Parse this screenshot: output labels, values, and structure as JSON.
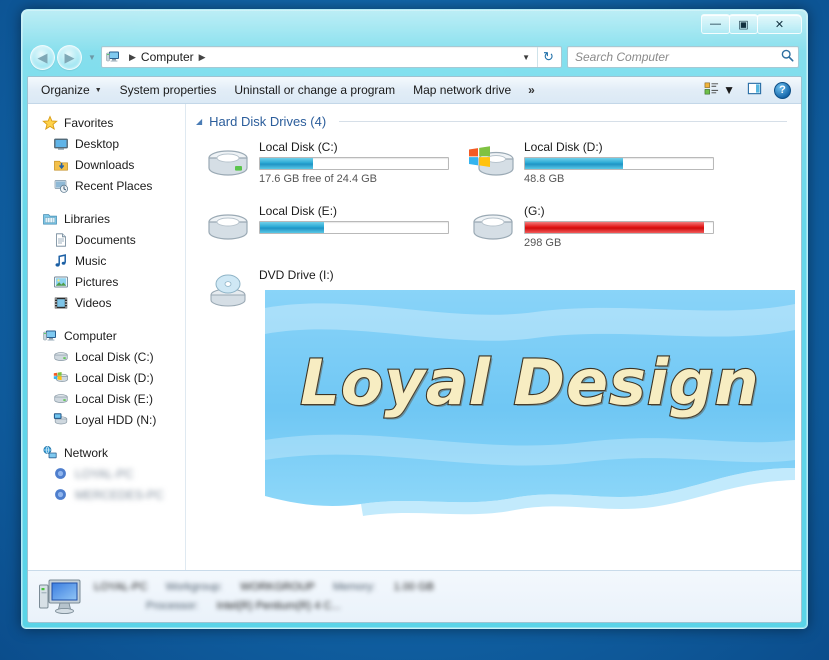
{
  "window": {
    "title": "",
    "caption_buttons": [
      {
        "name": "minimize",
        "glyph": "—"
      },
      {
        "name": "maximize",
        "glyph": "▣"
      },
      {
        "name": "close",
        "glyph": "✕"
      }
    ]
  },
  "navbar": {
    "back_glyph": "◀",
    "forward_glyph": "▶",
    "history_glyph": "▼",
    "breadcrumb_icon": "computer-icon",
    "breadcrumb": "Computer",
    "separator": "▶",
    "dropdown_glyph": "▼",
    "refresh_glyph": "↻",
    "search_placeholder": "Search Computer",
    "search_value": "",
    "search_icon": "search-icon"
  },
  "commandbar": {
    "organize": "Organize",
    "organize_caret": "▼",
    "system_properties": "System properties",
    "uninstall": "Uninstall or change a program",
    "map_network_drive": "Map network drive",
    "overflow": "»",
    "view_caret": "▼",
    "help_glyph": "?"
  },
  "navpane": {
    "groups": [
      {
        "header": {
          "label": "Favorites",
          "icon": "favorites-star-icon"
        },
        "items": [
          {
            "label": "Desktop",
            "icon": "desktop-icon",
            "blurred": false
          },
          {
            "label": "Downloads",
            "icon": "downloads-folder-icon",
            "blurred": false
          },
          {
            "label": "Recent Places",
            "icon": "recent-places-icon",
            "blurred": false
          }
        ]
      },
      {
        "header": {
          "label": "Libraries",
          "icon": "libraries-icon"
        },
        "items": [
          {
            "label": "Documents",
            "icon": "documents-icon",
            "blurred": false
          },
          {
            "label": "Music",
            "icon": "music-note-icon",
            "blurred": false
          },
          {
            "label": "Pictures",
            "icon": "pictures-icon",
            "blurred": false
          },
          {
            "label": "Videos",
            "icon": "videos-icon",
            "blurred": false
          }
        ]
      },
      {
        "header": {
          "label": "Computer",
          "icon": "computer-icon"
        },
        "items": [
          {
            "label": "Local Disk (C:)",
            "icon": "drive-icon",
            "blurred": false
          },
          {
            "label": "Local Disk (D:)",
            "icon": "system-drive-icon",
            "blurred": false
          },
          {
            "label": "Local Disk (E:)",
            "icon": "drive-icon",
            "blurred": false
          },
          {
            "label": "Loyal HDD (N:)",
            "icon": "network-drive-icon",
            "blurred": false
          }
        ]
      },
      {
        "header": {
          "label": "Network",
          "icon": "network-icon"
        },
        "items": [
          {
            "label": "LOYAL-PC",
            "icon": "network-computer-icon",
            "blurred": true
          },
          {
            "label": "MERCEDES-PC",
            "icon": "network-computer-icon",
            "blurred": true
          }
        ]
      }
    ]
  },
  "content": {
    "group_header": "Hard Disk Drives (4)",
    "group_caret": "◢",
    "drives": [
      {
        "name": "Local Disk (C:)",
        "icon": "drive-icon",
        "usage_percent": 28,
        "bar_color": "blue",
        "detail": "17.6 GB free of 24.4 GB"
      },
      {
        "name": "Local Disk (D:)",
        "icon": "system-drive-icon",
        "usage_percent": 52,
        "bar_color": "blue",
        "detail": "48.8 GB"
      },
      {
        "name": "Local Disk (E:)",
        "icon": "drive-icon",
        "usage_percent": 34,
        "bar_color": "blue",
        "detail": ""
      },
      {
        "name": "(G:)",
        "icon": "drive-icon",
        "usage_percent": 95,
        "bar_color": "red",
        "detail": "298 GB"
      }
    ],
    "dvd_drive": "DVD Drive (I:)"
  },
  "details": {
    "computer_name": "LOYAL-PC",
    "workgroup_key": "Workgroup:",
    "workgroup_value": "WORKGROUP",
    "memory_key": "Memory:",
    "memory_value": "1.00 GB",
    "processor_key": "Processor:",
    "processor_value": "Intel(R) Pentium(R) 4 C..."
  },
  "watermark": {
    "text": "Loyal Design"
  },
  "colors": {
    "aero_glass": "#6eddee",
    "accent_blue": "#2aa9d4",
    "warning_red": "#e21717",
    "header_blue": "#2b5d9b",
    "desktop": "#1268ab",
    "watermark_banner": "#6ec6f5",
    "watermark_text": "#f7edc2"
  }
}
